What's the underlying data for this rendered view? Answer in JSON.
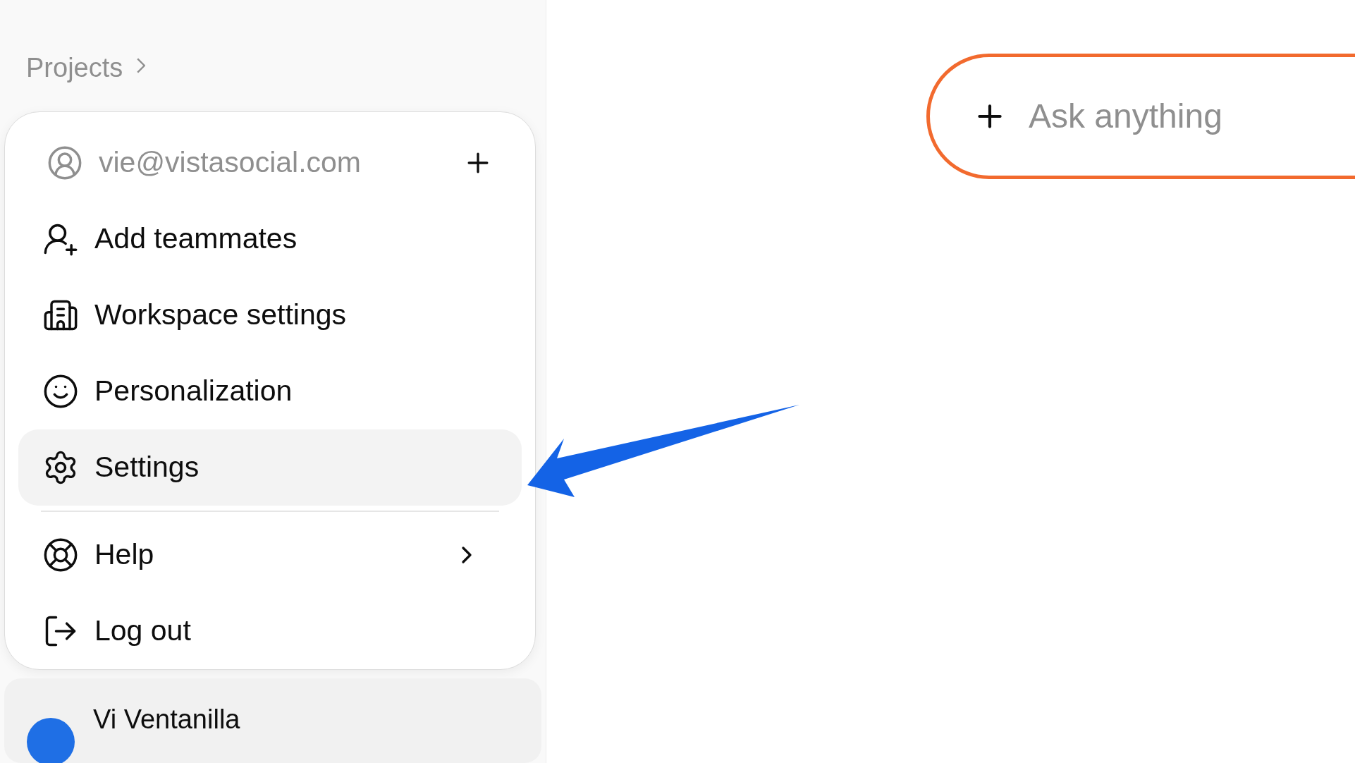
{
  "sidebar": {
    "breadcrumb": "Projects",
    "account_menu": {
      "email": "vie@vistasocial.com",
      "items": [
        {
          "kind": "item",
          "label": "Add teammates",
          "selected": false
        },
        {
          "kind": "item",
          "label": "Workspace settings",
          "selected": false
        },
        {
          "kind": "item",
          "label": "Personalization",
          "selected": false
        },
        {
          "kind": "item",
          "label": "Settings",
          "selected": true
        },
        {
          "kind": "divider"
        },
        {
          "kind": "submenu",
          "label": "Help",
          "selected": false
        },
        {
          "kind": "item",
          "label": "Log out",
          "selected": false
        }
      ]
    },
    "user": {
      "name": "Vi Ventanilla"
    }
  },
  "composer": {
    "placeholder": "Ask anything"
  }
}
